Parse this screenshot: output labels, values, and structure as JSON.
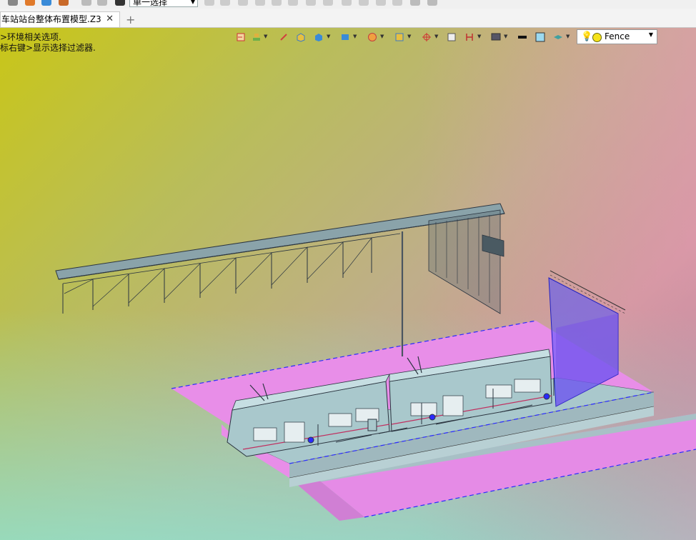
{
  "app": {
    "select_mode": "单一选择",
    "document_tab": "车站站台整体布置模型.Z3",
    "close_glyph": "✕",
    "add_tab_glyph": "+"
  },
  "hints": {
    "line1": ">环境相关选项.",
    "line2": "标右键>显示选择过滤器."
  },
  "view_toolbar": {
    "icons": [
      "undo-view-icon",
      "layer-icon",
      "pen-icon",
      "box-solid-icon",
      "cube-shaded-icon",
      "cube-display-icon",
      "texture-icon",
      "snap-frame-icon",
      "axis-icon",
      "page-icon",
      "dimension-icon",
      "monitor-icon",
      "line-weight-icon",
      "color-swatch-icon",
      "layers-stack-icon"
    ],
    "filter_value": "Fence"
  },
  "colors": {
    "platform_pink": "#e88ee8",
    "train_body": "#a9c8cc",
    "edge_blue": "#2a2aff"
  }
}
